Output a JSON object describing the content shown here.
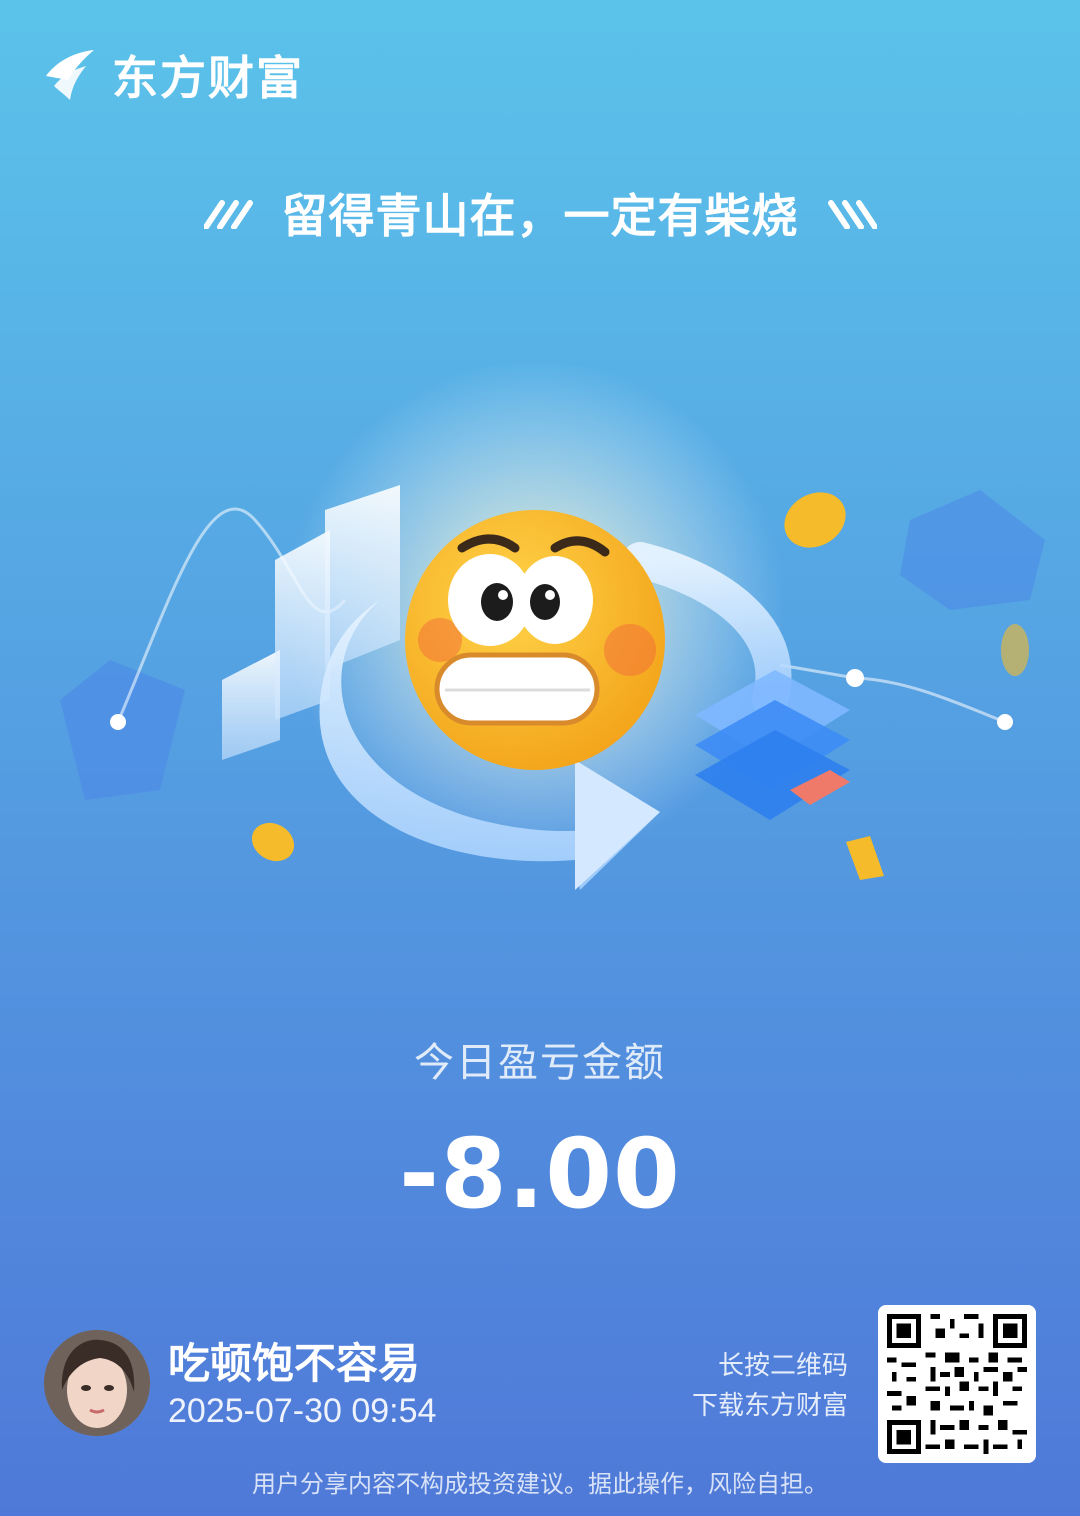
{
  "header": {
    "brand_name": "东方财富",
    "logo_icon": "eastmoney-logo-icon"
  },
  "slogan": {
    "text": "留得青山在，一定有柴烧",
    "left_icon": "slash-decor-icon",
    "right_icon": "backslash-decor-icon"
  },
  "illustration": {
    "icon": "grimacing-emoji-icon",
    "description_icon": "chart-cycle-illustration"
  },
  "pnl": {
    "label": "今日盈亏金额",
    "amount": "-8.00"
  },
  "user": {
    "name": "吃顿饱不容易",
    "timestamp": "2025-07-30 09:54",
    "avatar_icon": "avatar"
  },
  "qr": {
    "tip_line1": "长按二维码",
    "tip_line2": "下载东方财富",
    "icon": "qr-code"
  },
  "footer": {
    "disclaimer": "用户分享内容不构成投资建议。据此操作，风险自担。"
  },
  "colors": {
    "bg_top": "#5bc3ea",
    "bg_bottom": "#4f79d8",
    "emoji": "#f6b21c"
  }
}
